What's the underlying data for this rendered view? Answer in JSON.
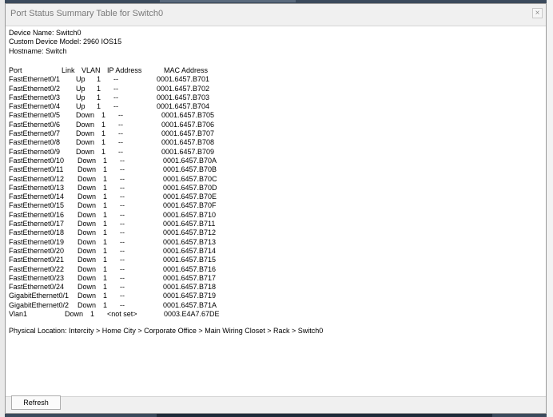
{
  "dialog": {
    "title": "Port Status Summary Table for Switch0",
    "close_label": "×"
  },
  "device": {
    "name_line": "Device Name: Switch0",
    "model_line": "Custom Device Model: 2960 IOS15",
    "hostname_line": "Hostname: Switch"
  },
  "table": {
    "headers": [
      "Port",
      "Link",
      "VLAN",
      "IP Address",
      "MAC Address"
    ],
    "rows": [
      [
        "FastEthernet0/1",
        "Up",
        "1",
        "--",
        "0001.6457.B701"
      ],
      [
        "FastEthernet0/2",
        "Up",
        "1",
        "--",
        "0001.6457.B702"
      ],
      [
        "FastEthernet0/3",
        "Up",
        "1",
        "--",
        "0001.6457.B703"
      ],
      [
        "FastEthernet0/4",
        "Up",
        "1",
        "--",
        "0001.6457.B704"
      ],
      [
        "FastEthernet0/5",
        "Down",
        "1",
        "--",
        "0001.6457.B705"
      ],
      [
        "FastEthernet0/6",
        "Down",
        "1",
        "--",
        "0001.6457.B706"
      ],
      [
        "FastEthernet0/7",
        "Down",
        "1",
        "--",
        "0001.6457.B707"
      ],
      [
        "FastEthernet0/8",
        "Down",
        "1",
        "--",
        "0001.6457.B708"
      ],
      [
        "FastEthernet0/9",
        "Down",
        "1",
        "--",
        "0001.6457.B709"
      ],
      [
        "FastEthernet0/10",
        "Down",
        "1",
        "--",
        "0001.6457.B70A"
      ],
      [
        "FastEthernet0/11",
        "Down",
        "1",
        "--",
        "0001.6457.B70B"
      ],
      [
        "FastEthernet0/12",
        "Down",
        "1",
        "--",
        "0001.6457.B70C"
      ],
      [
        "FastEthernet0/13",
        "Down",
        "1",
        "--",
        "0001.6457.B70D"
      ],
      [
        "FastEthernet0/14",
        "Down",
        "1",
        "--",
        "0001.6457.B70E"
      ],
      [
        "FastEthernet0/15",
        "Down",
        "1",
        "--",
        "0001.6457.B70F"
      ],
      [
        "FastEthernet0/16",
        "Down",
        "1",
        "--",
        "0001.6457.B710"
      ],
      [
        "FastEthernet0/17",
        "Down",
        "1",
        "--",
        "0001.6457.B711"
      ],
      [
        "FastEthernet0/18",
        "Down",
        "1",
        "--",
        "0001.6457.B712"
      ],
      [
        "FastEthernet0/19",
        "Down",
        "1",
        "--",
        "0001.6457.B713"
      ],
      [
        "FastEthernet0/20",
        "Down",
        "1",
        "--",
        "0001.6457.B714"
      ],
      [
        "FastEthernet0/21",
        "Down",
        "1",
        "--",
        "0001.6457.B715"
      ],
      [
        "FastEthernet0/22",
        "Down",
        "1",
        "--",
        "0001.6457.B716"
      ],
      [
        "FastEthernet0/23",
        "Down",
        "1",
        "--",
        "0001.6457.B717"
      ],
      [
        "FastEthernet0/24",
        "Down",
        "1",
        "--",
        "0001.6457.B718"
      ],
      [
        "GigabitEthernet0/1",
        "Down",
        "1",
        "--",
        "0001.6457.B719"
      ],
      [
        "GigabitEthernet0/2",
        "Down",
        "1",
        "--",
        "0001.6457.B71A"
      ],
      [
        "Vlan1",
        "Down",
        "1",
        "<not set>",
        "0003.E4A7.67DE"
      ]
    ]
  },
  "location_line": "Physical Location: Intercity > Home City > Corporate Office > Main Wiring Closet > Rack > Switch0",
  "buttons": {
    "refresh_label": "Refresh"
  }
}
